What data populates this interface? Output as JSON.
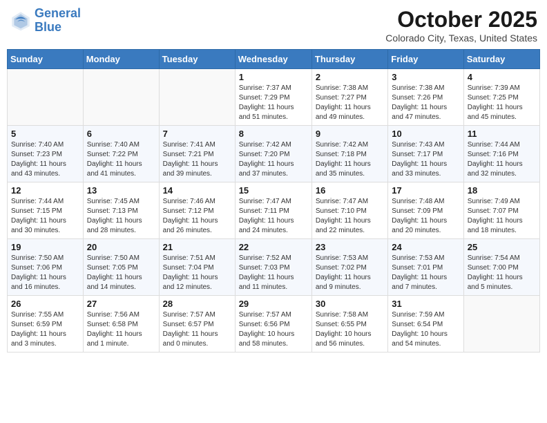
{
  "header": {
    "logo_line1": "General",
    "logo_line2": "Blue",
    "month": "October 2025",
    "location": "Colorado City, Texas, United States"
  },
  "days_of_week": [
    "Sunday",
    "Monday",
    "Tuesday",
    "Wednesday",
    "Thursday",
    "Friday",
    "Saturday"
  ],
  "weeks": [
    [
      {
        "day": "",
        "info": ""
      },
      {
        "day": "",
        "info": ""
      },
      {
        "day": "",
        "info": ""
      },
      {
        "day": "1",
        "info": "Sunrise: 7:37 AM\nSunset: 7:29 PM\nDaylight: 11 hours\nand 51 minutes."
      },
      {
        "day": "2",
        "info": "Sunrise: 7:38 AM\nSunset: 7:27 PM\nDaylight: 11 hours\nand 49 minutes."
      },
      {
        "day": "3",
        "info": "Sunrise: 7:38 AM\nSunset: 7:26 PM\nDaylight: 11 hours\nand 47 minutes."
      },
      {
        "day": "4",
        "info": "Sunrise: 7:39 AM\nSunset: 7:25 PM\nDaylight: 11 hours\nand 45 minutes."
      }
    ],
    [
      {
        "day": "5",
        "info": "Sunrise: 7:40 AM\nSunset: 7:23 PM\nDaylight: 11 hours\nand 43 minutes."
      },
      {
        "day": "6",
        "info": "Sunrise: 7:40 AM\nSunset: 7:22 PM\nDaylight: 11 hours\nand 41 minutes."
      },
      {
        "day": "7",
        "info": "Sunrise: 7:41 AM\nSunset: 7:21 PM\nDaylight: 11 hours\nand 39 minutes."
      },
      {
        "day": "8",
        "info": "Sunrise: 7:42 AM\nSunset: 7:20 PM\nDaylight: 11 hours\nand 37 minutes."
      },
      {
        "day": "9",
        "info": "Sunrise: 7:42 AM\nSunset: 7:18 PM\nDaylight: 11 hours\nand 35 minutes."
      },
      {
        "day": "10",
        "info": "Sunrise: 7:43 AM\nSunset: 7:17 PM\nDaylight: 11 hours\nand 33 minutes."
      },
      {
        "day": "11",
        "info": "Sunrise: 7:44 AM\nSunset: 7:16 PM\nDaylight: 11 hours\nand 32 minutes."
      }
    ],
    [
      {
        "day": "12",
        "info": "Sunrise: 7:44 AM\nSunset: 7:15 PM\nDaylight: 11 hours\nand 30 minutes."
      },
      {
        "day": "13",
        "info": "Sunrise: 7:45 AM\nSunset: 7:13 PM\nDaylight: 11 hours\nand 28 minutes."
      },
      {
        "day": "14",
        "info": "Sunrise: 7:46 AM\nSunset: 7:12 PM\nDaylight: 11 hours\nand 26 minutes."
      },
      {
        "day": "15",
        "info": "Sunrise: 7:47 AM\nSunset: 7:11 PM\nDaylight: 11 hours\nand 24 minutes."
      },
      {
        "day": "16",
        "info": "Sunrise: 7:47 AM\nSunset: 7:10 PM\nDaylight: 11 hours\nand 22 minutes."
      },
      {
        "day": "17",
        "info": "Sunrise: 7:48 AM\nSunset: 7:09 PM\nDaylight: 11 hours\nand 20 minutes."
      },
      {
        "day": "18",
        "info": "Sunrise: 7:49 AM\nSunset: 7:07 PM\nDaylight: 11 hours\nand 18 minutes."
      }
    ],
    [
      {
        "day": "19",
        "info": "Sunrise: 7:50 AM\nSunset: 7:06 PM\nDaylight: 11 hours\nand 16 minutes."
      },
      {
        "day": "20",
        "info": "Sunrise: 7:50 AM\nSunset: 7:05 PM\nDaylight: 11 hours\nand 14 minutes."
      },
      {
        "day": "21",
        "info": "Sunrise: 7:51 AM\nSunset: 7:04 PM\nDaylight: 11 hours\nand 12 minutes."
      },
      {
        "day": "22",
        "info": "Sunrise: 7:52 AM\nSunset: 7:03 PM\nDaylight: 11 hours\nand 11 minutes."
      },
      {
        "day": "23",
        "info": "Sunrise: 7:53 AM\nSunset: 7:02 PM\nDaylight: 11 hours\nand 9 minutes."
      },
      {
        "day": "24",
        "info": "Sunrise: 7:53 AM\nSunset: 7:01 PM\nDaylight: 11 hours\nand 7 minutes."
      },
      {
        "day": "25",
        "info": "Sunrise: 7:54 AM\nSunset: 7:00 PM\nDaylight: 11 hours\nand 5 minutes."
      }
    ],
    [
      {
        "day": "26",
        "info": "Sunrise: 7:55 AM\nSunset: 6:59 PM\nDaylight: 11 hours\nand 3 minutes."
      },
      {
        "day": "27",
        "info": "Sunrise: 7:56 AM\nSunset: 6:58 PM\nDaylight: 11 hours\nand 1 minute."
      },
      {
        "day": "28",
        "info": "Sunrise: 7:57 AM\nSunset: 6:57 PM\nDaylight: 11 hours\nand 0 minutes."
      },
      {
        "day": "29",
        "info": "Sunrise: 7:57 AM\nSunset: 6:56 PM\nDaylight: 10 hours\nand 58 minutes."
      },
      {
        "day": "30",
        "info": "Sunrise: 7:58 AM\nSunset: 6:55 PM\nDaylight: 10 hours\nand 56 minutes."
      },
      {
        "day": "31",
        "info": "Sunrise: 7:59 AM\nSunset: 6:54 PM\nDaylight: 10 hours\nand 54 minutes."
      },
      {
        "day": "",
        "info": ""
      }
    ]
  ]
}
